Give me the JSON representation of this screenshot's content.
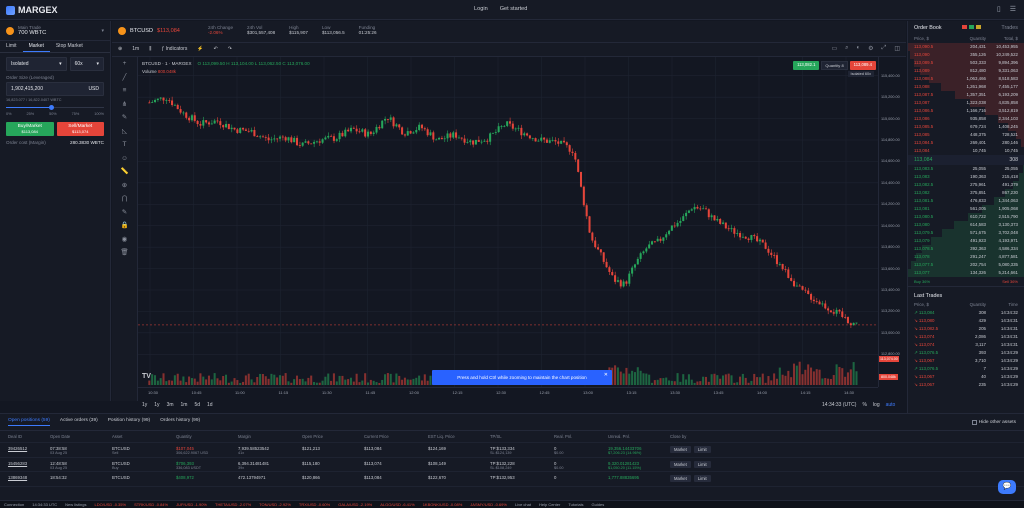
{
  "brand": {
    "name": "MARGEX"
  },
  "nav": {
    "login": "Login",
    "get_started": "Get started"
  },
  "account": {
    "label": "Main Trade",
    "balance": "700 WBTC"
  },
  "instrument": {
    "symbol": "BTCUSD",
    "last": "$113,084"
  },
  "stats": [
    {
      "label": "24h Change",
      "value": "-2.06%"
    },
    {
      "label": "24h Vol",
      "value": "$301,557,408"
    },
    {
      "label": "High",
      "value": "$115,907"
    },
    {
      "label": "Low",
      "value": "$113,056.5"
    },
    {
      "label": "Funding",
      "value": "01:25:26"
    }
  ],
  "order_form": {
    "tabs": [
      "Limit",
      "Market",
      "Stop Market"
    ],
    "active_tab": "Market",
    "margin_mode": "Isolated",
    "leverage": "60x",
    "size_label": "Order Size (Leveraged)",
    "size_value": "1,902,415,200",
    "size_unit": "USD",
    "size_hint": "16,823.077 / 16,822.0407 WBTC",
    "slider_marks": [
      "0%",
      "25%",
      "50%",
      "75%",
      "100%"
    ],
    "buy_label": "Buy/Market",
    "buy_price": "$113,084",
    "sell_label": "Sell/Market",
    "sell_price": "$113,074",
    "cost_label": "Order cost (Margin)",
    "cost_value": "280.3830 WBTC"
  },
  "chart_toolbar": {
    "interval": "1m",
    "indicators": "Indicators"
  },
  "chart_legend": {
    "title": "BTCUSD · 1 · MARGEX",
    "ohlc": "O 113,099.50 H 113,104.00 L 113,062.50 C 113,076.00",
    "volume": "Volume",
    "volume_val": "800.048k"
  },
  "quick_trade": {
    "sell": "113,082.1",
    "buy": "113,089.4",
    "qty_label": "Quantity",
    "qty": "8",
    "mode": "Isolated 60x"
  },
  "price_ticks": [
    "115,400.00",
    "115,200.00",
    "115,000.00",
    "114,800.00",
    "114,600.00",
    "114,400.00",
    "114,200.00",
    "114,000.00",
    "113,800.00",
    "113,600.00",
    "113,400.00",
    "113,200.00",
    "113,000.00",
    "112,800.00"
  ],
  "price_flags": {
    "current": "113,074.00",
    "volume": "800.048k"
  },
  "time_ticks": [
    "10:30",
    "10:45",
    "11:00",
    "11:15",
    "11:30",
    "11:45",
    "12:00",
    "12:15",
    "12:30",
    "12:45",
    "13:00",
    "13:15",
    "13:30",
    "13:45",
    "14:00",
    "14:15",
    "14:30"
  ],
  "time_ranges": [
    "1y",
    "1y",
    "3m",
    "1m",
    "5d",
    "1d"
  ],
  "timestamp": "14:34:33 (UTC)",
  "axis_controls": [
    "%",
    "log",
    "auto"
  ],
  "toast": "Press and hold Ctrl while zooming to maintain the chart position",
  "orderbook": {
    "title": "Order Book",
    "tab": "Trades",
    "headers": [
      "Price, $",
      "Quantity",
      "Total, $"
    ],
    "asks": [
      [
        "113,090.5",
        "204,431",
        "10,453,955"
      ],
      [
        "113,090",
        "355,126",
        "10,249,522"
      ],
      [
        "113,089.5",
        "503,333",
        "9,894,396"
      ],
      [
        "113,089",
        "812,480",
        "9,331,063"
      ],
      [
        "113,088.5",
        "1,063,466",
        "8,518,583"
      ],
      [
        "113,088",
        "1,261,968",
        "7,455,177"
      ],
      [
        "113,087.5",
        "1,357,351",
        "6,193,209"
      ],
      [
        "113,087",
        "1,323,038",
        "4,835,858"
      ],
      [
        "113,086.5",
        "1,166,716",
        "3,512,819"
      ],
      [
        "113,086",
        "935,858",
        "2,344,103"
      ],
      [
        "113,085.5",
        "679,724",
        "1,408,245"
      ],
      [
        "113,085",
        "448,375",
        "728,521"
      ],
      [
        "113,084.5",
        "269,401",
        "280,146"
      ],
      [
        "113,084",
        "10,745",
        "10,745"
      ]
    ],
    "spread_price": "113,084",
    "spread_qty": "308",
    "bids": [
      [
        "113,083.5",
        "25,055",
        "25,055"
      ],
      [
        "113,083",
        "190,363",
        "215,418"
      ],
      [
        "113,082.5",
        "275,961",
        "491,379"
      ],
      [
        "113,082",
        "375,851",
        "867,230"
      ],
      [
        "113,081.5",
        "476,833",
        "1,344,063"
      ],
      [
        "113,081",
        "561,005",
        "1,905,068"
      ],
      [
        "113,080.5",
        "610,722",
        "2,515,790"
      ],
      [
        "113,080",
        "614,583",
        "3,130,373"
      ],
      [
        "113,079.5",
        "571,675",
        "3,702,048"
      ],
      [
        "113,079",
        "491,923",
        "4,193,971"
      ],
      [
        "113,078.5",
        "392,363",
        "4,586,334"
      ],
      [
        "113,078",
        "291,247",
        "4,877,581"
      ],
      [
        "113,077.5",
        "202,754",
        "5,080,335"
      ],
      [
        "113,077",
        "134,326",
        "5,214,661"
      ]
    ],
    "buy_pct": "Buy 36%",
    "sell_pct": "Sell 36%"
  },
  "last_trades": {
    "title": "Last Trades",
    "headers": [
      "Price, $",
      "Quantity",
      "Time"
    ],
    "rows": [
      [
        "113,084",
        "308",
        "14:34:32",
        "buy"
      ],
      [
        "113,080",
        "429",
        "14:34:31",
        "sell"
      ],
      [
        "113,082.5",
        "205",
        "14:34:31",
        "sell"
      ],
      [
        "113,074",
        "2,086",
        "14:34:31",
        "sell"
      ],
      [
        "113,074",
        "3,117",
        "14:34:31",
        "sell"
      ],
      [
        "113,076.5",
        "393",
        "14:34:29",
        "buy"
      ],
      [
        "113,067",
        "3,710",
        "14:34:29",
        "sell"
      ],
      [
        "113,076.5",
        "7",
        "14:34:29",
        "buy"
      ],
      [
        "113,067",
        "40",
        "14:34:29",
        "sell"
      ],
      [
        "113,067",
        "235",
        "14:34:29",
        "sell"
      ]
    ]
  },
  "bottom": {
    "tabs": [
      "Open positions (59)",
      "Active orders (39)",
      "Position history (99)",
      "Orders history (99)"
    ],
    "hide_other": "Hide other assets",
    "headers": [
      "Deal ID",
      "Open Date",
      "Asset",
      "Quantity",
      "Margin",
      "Open Price",
      "Current Price",
      "EST Liq. Price",
      "TP/SL",
      "Real. Pnl.",
      "Unreal. Pnl.",
      "Close by"
    ],
    "rows": [
      {
        "id": "39426512",
        "date": "07:38:58",
        "date2": "03 Aug 25",
        "asset": "BTCUSD",
        "side": "Sell",
        "qty": "$107,045",
        "qty2": "306,622.9067 USD",
        "margin": "7,939.58523542",
        "margin2": "41x",
        "open": "$121,213",
        "current": "$113,084",
        "liq": "$124,169",
        "tp": "TP:$133,334",
        "sl": "SL:$124,139",
        "real": "0",
        "real2": "$0.00",
        "unreal": "19,356.14433706",
        "unreal2": "$7,206.23 (14.96%)",
        "market": "Market",
        "limit": "Limit"
      },
      {
        "id": "15456283",
        "date": "12:48:58",
        "date2": "03 Aug 25",
        "asset": "BTCUSD",
        "side": "Buy",
        "qty": "$706,393",
        "qty2": "336,083 USDT",
        "margin": "6,394.31481481",
        "margin2": "39x",
        "open": "$115,180",
        "current": "$113,074",
        "liq": "$108,149",
        "tp": "TP:$132,228",
        "sl": "SL:$108,249",
        "real": "0",
        "real2": "$0.00",
        "unreal": "9,320.01281423",
        "unreal2": "$1,050.20 (11.15%)",
        "market": "Market",
        "limit": "Limit"
      },
      {
        "id": "13869348",
        "date": "18:54:32",
        "date2": "",
        "asset": "BTCUSD",
        "side": "",
        "qty": "$408,972",
        "qty2": "",
        "margin": "472.13794971",
        "margin2": "",
        "open": "$120,866",
        "current": "$113,084",
        "liq": "$122,670",
        "tp": "TP:$132,953",
        "sl": "",
        "real": "0",
        "real2": "",
        "unreal": "1,777.88835695",
        "unreal2": "",
        "market": "Market",
        "limit": "Limit"
      }
    ]
  },
  "ticker": [
    "Connection",
    "14:34:33 UTC",
    "New listings",
    "LDO/USD -0.35%",
    "STRK/USD -0.84%",
    "JUP/USD -1.90%",
    "THETA/USD -2.07%",
    "TON/USD -2.92%",
    "TRX/USD -0.60%",
    "GALA/USD -2.19%",
    "ALGO/USD -6.41%",
    "1KBONK/USD -0.08%",
    "JASMY/USD -0.69%",
    "Live chat",
    "Help Center",
    "Tutorials",
    "Guides"
  ],
  "chart_data": {
    "type": "candlestick",
    "title": "BTCUSD · 1 · MARGEX",
    "x_range": [
      "10:25",
      "14:34"
    ],
    "ylim": [
      112700,
      115500
    ],
    "close_path": [
      [
        0,
        115150
      ],
      [
        3,
        115200
      ],
      [
        6,
        115050
      ],
      [
        9,
        114950
      ],
      [
        12,
        114980
      ],
      [
        15,
        114900
      ],
      [
        18,
        114880
      ],
      [
        21,
        114800
      ],
      [
        24,
        114830
      ],
      [
        27,
        114750
      ],
      [
        30,
        114800
      ],
      [
        33,
        114820
      ],
      [
        36,
        114900
      ],
      [
        39,
        114850
      ],
      [
        42,
        115020
      ],
      [
        45,
        114870
      ],
      [
        48,
        114920
      ],
      [
        51,
        114800
      ],
      [
        54,
        114850
      ],
      [
        57,
        114780
      ],
      [
        60,
        114820
      ],
      [
        63,
        114950
      ],
      [
        66,
        114870
      ],
      [
        69,
        114800
      ],
      [
        72,
        114780
      ],
      [
        75,
        114700
      ],
      [
        78,
        113900
      ],
      [
        80,
        113700
      ],
      [
        82,
        113500
      ],
      [
        84,
        113450
      ],
      [
        86,
        113650
      ],
      [
        88,
        113800
      ],
      [
        90,
        113850
      ],
      [
        92,
        113980
      ],
      [
        94,
        114050
      ],
      [
        96,
        114180
      ],
      [
        98,
        114150
      ],
      [
        100,
        114050
      ],
      [
        103,
        113950
      ],
      [
        106,
        113900
      ],
      [
        109,
        113800
      ],
      [
        112,
        113600
      ],
      [
        115,
        113400
      ],
      [
        118,
        113300
      ],
      [
        121,
        113200
      ],
      [
        124,
        113100
      ],
      [
        125,
        113084
      ]
    ],
    "current_price": 113074,
    "volume_last": "800.048k"
  }
}
